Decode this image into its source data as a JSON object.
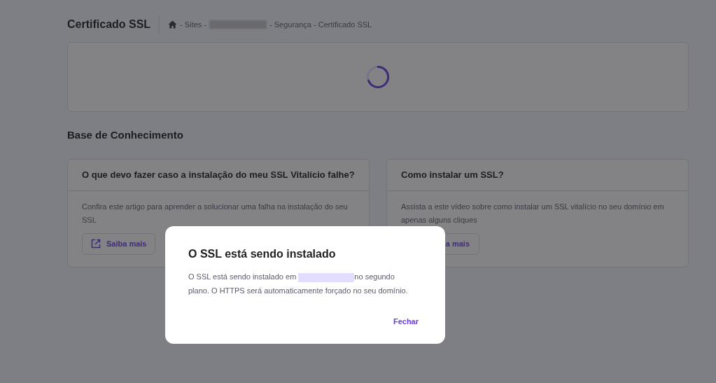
{
  "page_title": "Certificado SSL",
  "breadcrumbs": [
    {
      "kind": "home"
    },
    {
      "kind": "text",
      "label": "- Sites -"
    },
    {
      "kind": "redacted"
    },
    {
      "kind": "text",
      "label": "- Segurança - Certificado SSL"
    }
  ],
  "status_card": {
    "loading": true
  },
  "section_title": "Base de Conhecimento",
  "articles": [
    {
      "title": "O que devo fazer caso a instalação do meu SSL Vitalício falhe?",
      "description": "Confira este artigo para aprender a solucionar uma falha na instalação do seu SSL",
      "button": "Saiba mais",
      "icon_visible": true
    },
    {
      "title": "Como instalar um SSL?",
      "description": "Assista a este vídeo sobre como instalar um SSL vitalício no seu domínio em apenas alguns cliques",
      "button": "a mais",
      "icon_visible": false
    }
  ],
  "modal": {
    "title": "O SSL está sendo instalado",
    "text_before": "O SSL está sendo instalado em",
    "text_after": "no segundo plano. O HTTPS será automaticamente forçado no seu domínio.",
    "close_button": "Fechar"
  }
}
